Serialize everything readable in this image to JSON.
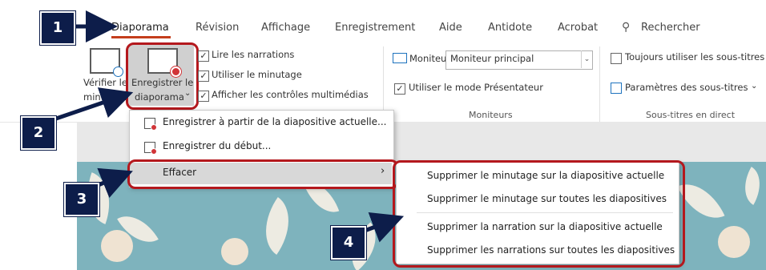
{
  "tabs": [
    {
      "label": "Diaporama",
      "active": true
    },
    {
      "label": "Révision"
    },
    {
      "label": "Affichage"
    },
    {
      "label": "Enregistrement"
    },
    {
      "label": "Aide"
    },
    {
      "label": "Antidote"
    },
    {
      "label": "Acrobat"
    }
  ],
  "search": {
    "placeholder": "Rechercher",
    "icon": "search-icon"
  },
  "ribbon": {
    "check_timing": {
      "line1": "Vérifier le",
      "line2": "minutage"
    },
    "record_slideshow": {
      "line1": "Enregistrer le",
      "line2": "diaporama",
      "caret": "⌄"
    },
    "options": [
      {
        "label": "Lire les narrations",
        "checked": true
      },
      {
        "label": "Utiliser le minutage",
        "checked": true
      },
      {
        "label": "Afficher les contrôles multimédias",
        "checked": true
      }
    ],
    "monitors": {
      "monitor_label": "Moniteur :",
      "monitor_value": "Moniteur principal",
      "presenter_view": "Utiliser le mode Présentateur",
      "group_title": "Moniteurs"
    },
    "subtitles": {
      "always_use": "Toujours utiliser les sous-titres",
      "settings": "Paramètres des sous-titres",
      "group_title": "Sous-titres en direct"
    }
  },
  "record_menu": {
    "items": [
      {
        "label": "Enregistrer à partir de la diapositive actuelle..."
      },
      {
        "label": "Enregistrer du début..."
      },
      {
        "label": "Effacer",
        "submenu": true
      }
    ]
  },
  "clear_submenu": {
    "items": [
      {
        "label": "Supprimer le minutage sur la diapositive actuelle"
      },
      {
        "label": "Supprimer le minutage sur toutes les diapositives"
      },
      {
        "label": "Supprimer la narration sur la diapositive actuelle"
      },
      {
        "label": "Supprimer les narrations sur toutes les diapositives"
      }
    ]
  },
  "callouts": [
    "1",
    "2",
    "3",
    "4"
  ],
  "colors": {
    "accent_tab": "#c43e1c",
    "highlight_box": "#b4181d",
    "callout_bg": "#0d1d4a",
    "slide_bg": "#7eb3bd"
  }
}
